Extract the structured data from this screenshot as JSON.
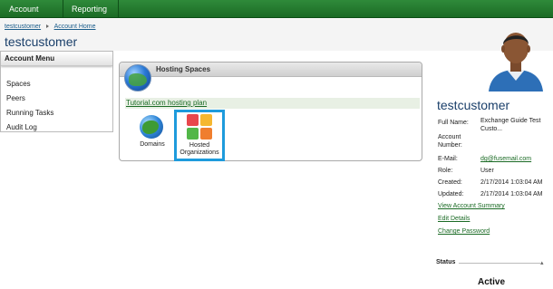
{
  "nav": {
    "home_label": "Account Home",
    "reporting_label": "Reporting"
  },
  "breadcrumb": {
    "items": [
      "testcustomer",
      "Account Home"
    ]
  },
  "page": {
    "title": "testcustomer"
  },
  "menu": {
    "title": "Account Menu",
    "items": [
      "Spaces",
      "Peers",
      "Running Tasks",
      "Audit Log"
    ]
  },
  "hosting": {
    "title": "Hosting Spaces",
    "plan_link": "Tutorial.com hosting plan",
    "tiles": [
      {
        "label": "Domains",
        "icon": "globe-icon"
      },
      {
        "label": "Hosted Organizations",
        "icon": "organizations-grid-icon"
      }
    ]
  },
  "account": {
    "name": "testcustomer",
    "fields": [
      {
        "label": "Full Name:",
        "value": "Exchange Guide Test Custo..."
      },
      {
        "label": "Account Number:",
        "value": ""
      },
      {
        "label": "E-Mail:",
        "value": "dg@fusemail.com"
      },
      {
        "label": "Role:",
        "value": "User"
      },
      {
        "label": "Created:",
        "value": "2/17/2014 1:03:04 AM"
      },
      {
        "label": "Updated:",
        "value": "2/17/2014 1:03:04 AM"
      }
    ],
    "links": [
      "View Account Summary",
      "Edit Details",
      "Change Password"
    ]
  },
  "status": {
    "title": "Status",
    "value": "Active"
  },
  "colors": {
    "nav_green": "#1b6b25",
    "title_blue": "#1a3f6a",
    "link_green": "#1b6b25",
    "selection_blue": "#1e9bdc"
  }
}
